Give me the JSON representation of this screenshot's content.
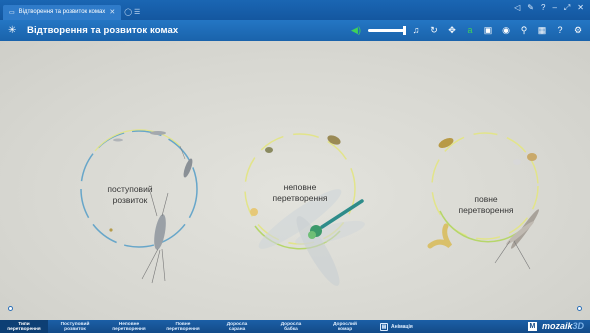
{
  "window": {
    "tab_title": "Відтворення та розвиток комах",
    "controls": [
      "◁",
      "✎",
      "?",
      "–",
      "⤢",
      "✕"
    ]
  },
  "app": {
    "title": "Відтворення та розвиток комах",
    "toolbar_icons": [
      "volume-icon",
      "music-icon",
      "refresh-icon",
      "move-icon",
      "text-icon",
      "film-icon",
      "camera-icon",
      "link-icon",
      "grid-icon",
      "help-icon",
      "settings-icon"
    ],
    "toolbar_glyphs": [
      "♫",
      "↻",
      "✥",
      "a",
      "▣",
      "◉",
      "⚲",
      "▦",
      "?",
      "⚙"
    ]
  },
  "cycles": [
    {
      "id": "gradual",
      "label_lines": [
        "поступовий",
        "розвиток"
      ]
    },
    {
      "id": "incomplete",
      "label_lines": [
        "неповне",
        "перетворення"
      ]
    },
    {
      "id": "complete",
      "label_lines": [
        "повне",
        "перетворення"
      ]
    }
  ],
  "colors": {
    "ring_blue": "#5aa0c8",
    "ring_yellow": "#e2e48a",
    "ring_green": "#b6d66a",
    "accent": "#1a63ab"
  },
  "bottom_nav": {
    "items": [
      {
        "label_lines": [
          "Типи",
          "перетворення"
        ],
        "active": true
      },
      {
        "label_lines": [
          "Поступовий",
          "розвиток"
        ],
        "active": false
      },
      {
        "label_lines": [
          "Неповне",
          "перетворення"
        ],
        "active": false
      },
      {
        "label_lines": [
          "Повне",
          "перетворення"
        ],
        "active": false
      },
      {
        "label_lines": [
          "Доросла",
          "сарана"
        ],
        "active": false
      },
      {
        "label_lines": [
          "Доросла",
          "бабка"
        ],
        "active": false
      },
      {
        "label_lines": [
          "Дорослий",
          "комар"
        ],
        "active": false
      }
    ],
    "animation_label": "Анімація",
    "brand_text": "mozaik",
    "brand_suffix": "3D"
  }
}
